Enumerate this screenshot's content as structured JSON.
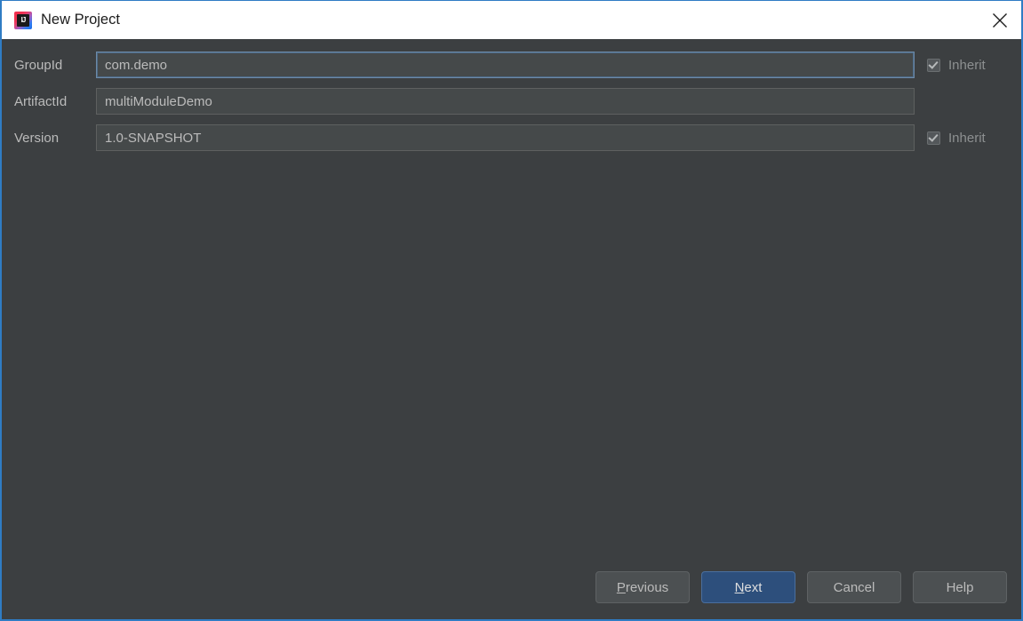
{
  "titlebar": {
    "title": "New Project",
    "app_icon": "intellij-idea-logo-icon",
    "close_icon": "close-icon"
  },
  "form": {
    "rows": [
      {
        "label": "GroupId",
        "value": "com.demo",
        "focused": true,
        "inherit": {
          "label": "Inherit",
          "checked": true,
          "enabled": false,
          "visible": true
        }
      },
      {
        "label": "ArtifactId",
        "value": "multiModuleDemo",
        "focused": false,
        "inherit": {
          "label": "",
          "checked": false,
          "enabled": false,
          "visible": false
        }
      },
      {
        "label": "Version",
        "value": "1.0-SNAPSHOT",
        "focused": false,
        "inherit": {
          "label": "Inherit",
          "checked": true,
          "enabled": false,
          "visible": true
        }
      }
    ]
  },
  "footer": {
    "buttons": [
      {
        "label": "Previous",
        "mnemonic": "P",
        "rest": "revious",
        "default": false
      },
      {
        "label": "Next",
        "mnemonic": "N",
        "rest": "ext",
        "default": true
      },
      {
        "label": "Cancel",
        "mnemonic": "",
        "rest": "Cancel",
        "default": false
      },
      {
        "label": "Help",
        "mnemonic": "",
        "rest": "Help",
        "default": false
      }
    ]
  },
  "colors": {
    "panel_bg": "#3c3f41",
    "field_bg": "#45494a",
    "text": "#bbbbbb",
    "accent_blue": "#2f7cc4",
    "default_button_bg": "#2d4f7c",
    "titlebar_bg": "#ffffff",
    "titlebar_text": "#1c1c1c"
  }
}
